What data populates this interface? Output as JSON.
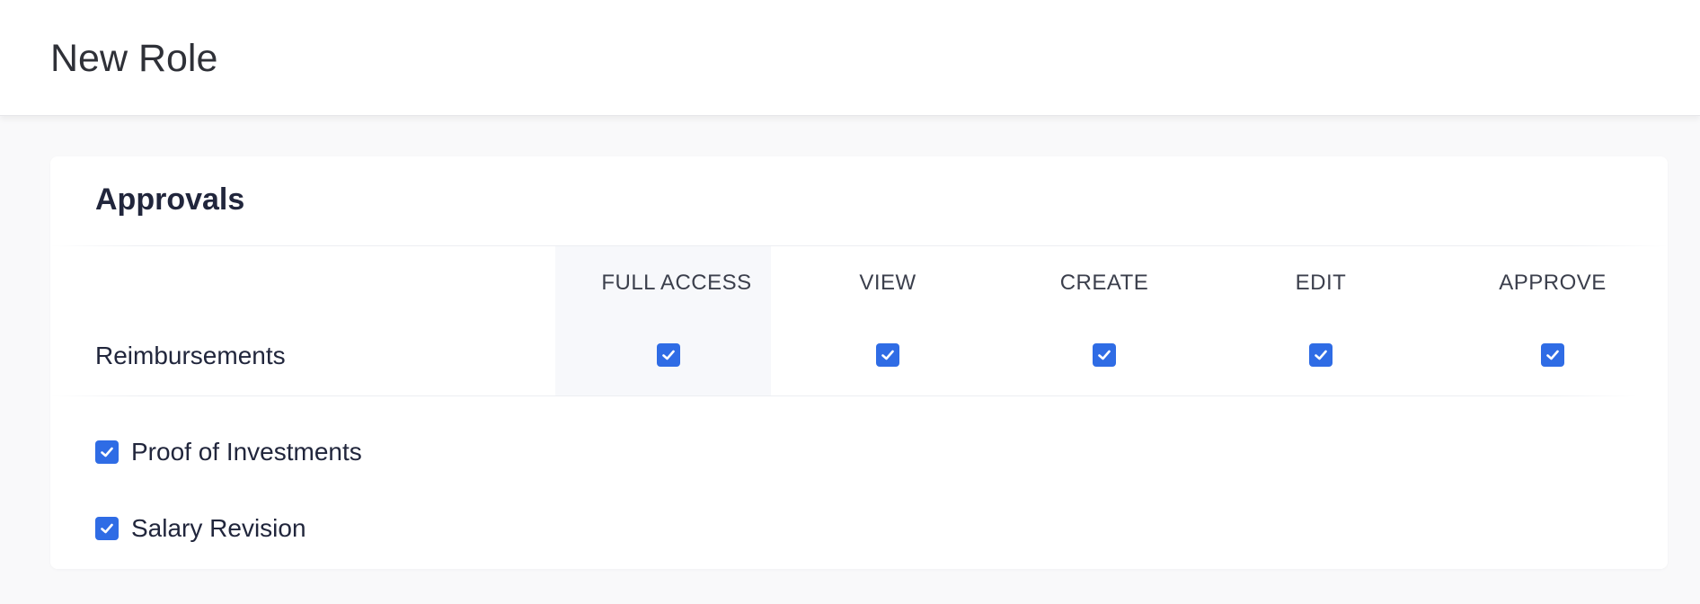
{
  "header": {
    "title": "New Role"
  },
  "approvals": {
    "title": "Approvals",
    "columns": [
      "FULL ACCESS",
      "VIEW",
      "CREATE",
      "EDIT",
      "APPROVE"
    ],
    "rows": [
      {
        "label": "Reimbursements",
        "checked": [
          true,
          true,
          true,
          true,
          true
        ]
      }
    ],
    "standalone_items": [
      {
        "label": "Proof of Investments",
        "checked": true
      },
      {
        "label": "Salary Revision",
        "checked": true
      }
    ]
  },
  "colors": {
    "accent": "#2f6ce5",
    "column_highlight": "#f7f8fb",
    "text_primary": "#21263c"
  },
  "icons": {
    "checkbox": "checkmark-icon"
  }
}
